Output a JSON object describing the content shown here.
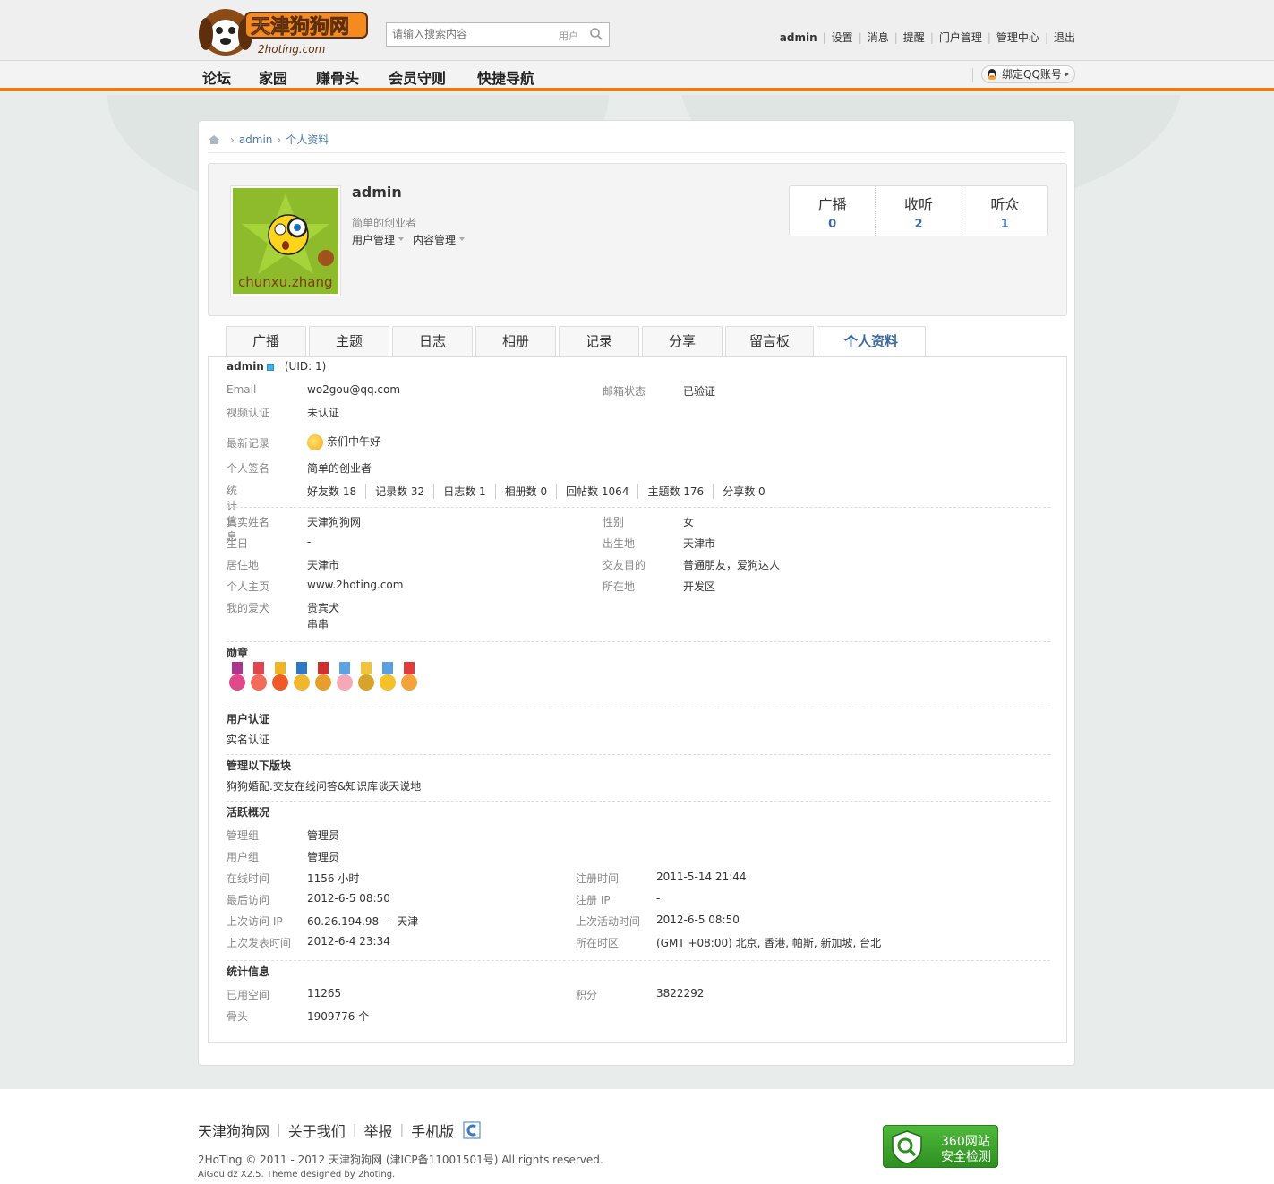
{
  "header": {
    "search_placeholder": "请输入搜索内容",
    "search_type": "用户",
    "top_links": [
      "设置",
      "消息",
      "提醒",
      "门户管理",
      "管理中心",
      "退出"
    ],
    "current_user": "admin",
    "qq_bind": "绑定QQ账号"
  },
  "nav": {
    "items": [
      "论坛",
      "家园",
      "赚骨头",
      "会员守则",
      "快捷导航"
    ]
  },
  "breadcrumb": {
    "items": [
      "admin",
      "个人资料"
    ]
  },
  "profile": {
    "name": "admin",
    "avatar_text": "chunxu.zhang",
    "signature": "简单的创业者",
    "menu": [
      "用户管理",
      "内容管理"
    ],
    "stats": [
      {
        "label": "广播",
        "value": "0"
      },
      {
        "label": "收听",
        "value": "2"
      },
      {
        "label": "听众",
        "value": "1"
      }
    ]
  },
  "tabs": [
    "广播",
    "主题",
    "日志",
    "相册",
    "记录",
    "分享",
    "留言板",
    "个人资料"
  ],
  "details": {
    "username": "admin",
    "uid": "(UID: 1)",
    "email_label": "Email",
    "email": "wo2gou@qq.com",
    "email_status_label": "邮箱状态",
    "email_status": "已验证",
    "video_label": "视频认证",
    "video": "未认证",
    "latest_label": "最新记录",
    "latest": "亲们中午好",
    "sig_label": "个人签名",
    "sig": "简单的创业者",
    "stat_label": "统计信息",
    "stats": [
      "好友数 18",
      "记录数 32",
      "日志数 1",
      "相册数 0",
      "回帖数 1064",
      "主题数 176",
      "分享数 0"
    ],
    "realname_label": "真实姓名",
    "realname": "天津狗狗网",
    "gender_label": "性别",
    "gender": "女",
    "birthday_label": "生日",
    "birthday": "-",
    "birthplace_label": "出生地",
    "birthplace": "天津市",
    "residence_label": "居住地",
    "residence": "天津市",
    "purpose_label": "交友目的",
    "purpose": "普通朋友，爱狗达人",
    "homepage_label": "个人主页",
    "homepage": "www.2hoting.com",
    "location_label": "所在地",
    "location": "开发区",
    "dog_label": "我的爱犬",
    "dog1": "贵宾犬",
    "dog2": "串串",
    "medal_title": "勋章",
    "verify_title": "用户认证",
    "verify": "实名认证",
    "boards_title": "管理以下版块",
    "boards": [
      "狗狗婚配.交友",
      "在线问答&知识库",
      "谈天说地"
    ],
    "activity_title": "活跃概况",
    "admingroup_label": "管理组",
    "admingroup": "管理员",
    "usergroup_label": "用户组",
    "usergroup": "管理员",
    "online_label": "在线时间",
    "online": "1156 小时",
    "regtime_label": "注册时间",
    "regtime": "2011-5-14 21:44",
    "lastvisit_label": "最后访问",
    "lastvisit": "2012-6-5 08:50",
    "regip_label": "注册 IP",
    "regip": "-",
    "lastip_label": "上次访问 IP",
    "lastip": "60.26.194.98 - - 天津",
    "lastactive_label": "上次活动时间",
    "lastactive": "2012-6-5 08:50",
    "lastpost_label": "上次发表时间",
    "lastpost": "2012-6-4 23:34",
    "timezone_label": "所在时区",
    "timezone": "(GMT +08:00) 北京, 香港, 帕斯, 新加坡, 台北",
    "stats_title": "统计信息",
    "space_label": "已用空间",
    "space": "11265",
    "credits_label": "积分",
    "credits": "3822292",
    "bones_label": "骨头",
    "bones": "1909776 个"
  },
  "footer": {
    "links": [
      "天津狗狗网",
      "关于我们",
      "举报",
      "手机版"
    ],
    "copyright": "2HoTing © 2011 - 2012 天津狗狗网 (津ICP备11001501号) All rights reserved.",
    "powered": "AiGou dz X2.5. Theme designed by 2hoting.",
    "badge_line1": "360网站",
    "badge_line2": "安全检测"
  },
  "colors": {
    "accent": "#f07b12",
    "link": "#3b6aa0"
  }
}
